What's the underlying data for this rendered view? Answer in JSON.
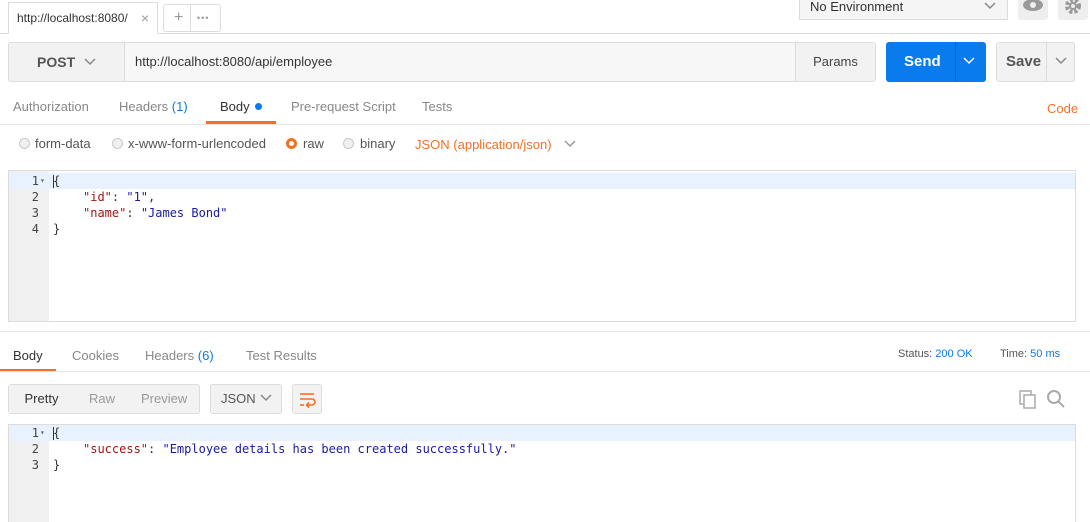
{
  "tab": {
    "title": "http://localhost:8080/",
    "close": "×"
  },
  "tab_actions": {
    "add": "+",
    "more": "•••"
  },
  "environment": {
    "selected": "No Environment"
  },
  "request": {
    "method": "POST",
    "url": "http://localhost:8080/api/employee",
    "params_label": "Params",
    "send_label": "Send",
    "save_label": "Save"
  },
  "request_tabs": [
    {
      "label": "Authorization"
    },
    {
      "label": "Headers",
      "count": "(1)"
    },
    {
      "label": "Body"
    },
    {
      "label": "Pre-request Script"
    },
    {
      "label": "Tests"
    }
  ],
  "code_link": "Code",
  "body_types": [
    {
      "label": "form-data",
      "selected": false
    },
    {
      "label": "x-www-form-urlencoded",
      "selected": false
    },
    {
      "label": "raw",
      "selected": true
    },
    {
      "label": "binary",
      "selected": false
    }
  ],
  "content_type": "JSON (application/json)",
  "request_body": {
    "lines": [
      "1",
      "2",
      "3",
      "4"
    ],
    "open": "{",
    "id_key": "\"id\"",
    "id_val": "\"1\"",
    "name_key": "\"name\"",
    "name_val": "\"James Bond\"",
    "close": "}"
  },
  "response_tabs": [
    {
      "label": "Body"
    },
    {
      "label": "Cookies"
    },
    {
      "label": "Headers",
      "count": "(6)"
    },
    {
      "label": "Test Results"
    }
  ],
  "response_meta": {
    "status_label": "Status:",
    "status_value": "200 OK",
    "time_label": "Time:",
    "time_value": "50 ms"
  },
  "view_modes": [
    "Pretty",
    "Raw",
    "Preview"
  ],
  "response_format": "JSON",
  "response_body": {
    "lines": [
      "1",
      "2",
      "3"
    ],
    "open": "{",
    "key": "\"success\"",
    "value": "\"Employee details has been created successfully.\"",
    "close": "}"
  },
  "colors": {
    "accent": "#f47023",
    "primary": "#097bed"
  }
}
